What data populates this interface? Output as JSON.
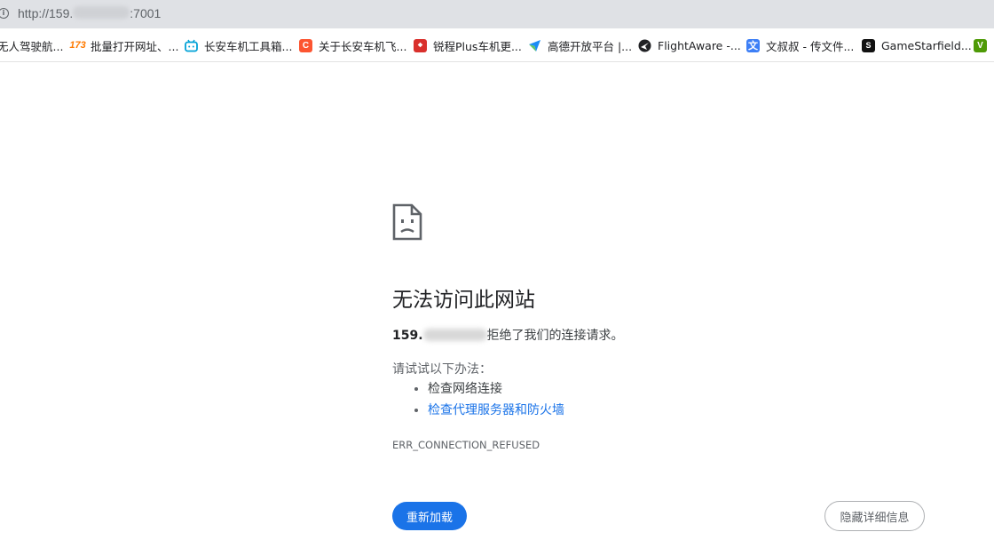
{
  "address_bar": {
    "url_prefix": "http://159.",
    "url_suffix": ":7001"
  },
  "bookmarks": [
    {
      "label": "无人驾驶航...",
      "icon": "none",
      "color": "#ffffff"
    },
    {
      "label": "批量打开网址、...",
      "icon": "173-logo-icon",
      "color": "#ff7a00"
    },
    {
      "label": "长安车机工具箱...",
      "icon": "bilibili-tv-icon",
      "color": "#00a1d6"
    },
    {
      "label": "关于长安车机飞...",
      "icon": "csdn-c-icon",
      "color": "#fc5531"
    },
    {
      "label": "锐程Plus车机更...",
      "icon": "app-logo-icon",
      "color": "#d9302c"
    },
    {
      "label": "高德开放平台 |...",
      "icon": "amap-arrow-icon",
      "color": "#1b8cf5"
    },
    {
      "label": "FlightAware -...",
      "icon": "flightaware-globe-icon",
      "color": "#202124"
    },
    {
      "label": "文叔叔 - 传文件...",
      "icon": "wenshushu-icon",
      "color": "#3d7ff6"
    },
    {
      "label": "GameStarfield...",
      "icon": "gamestarfield-icon",
      "color": "#111111"
    },
    {
      "label": "",
      "icon": "vim-icon",
      "color": "#4e9a06"
    }
  ],
  "error_page": {
    "title": "无法访问此网站",
    "host_prefix": "159.",
    "refused_text": "拒绝了我们的连接请求。",
    "try_title": "请试试以下办法：",
    "suggestions": [
      "检查网络连接",
      "检查代理服务器和防火墙"
    ],
    "error_code": "ERR_CONNECTION_REFUSED",
    "reload_label": "重新加载",
    "details_label": "隐藏详细信息"
  },
  "colors": {
    "accent": "#1a73e8",
    "address_bar_bg": "#dfe1e5"
  }
}
